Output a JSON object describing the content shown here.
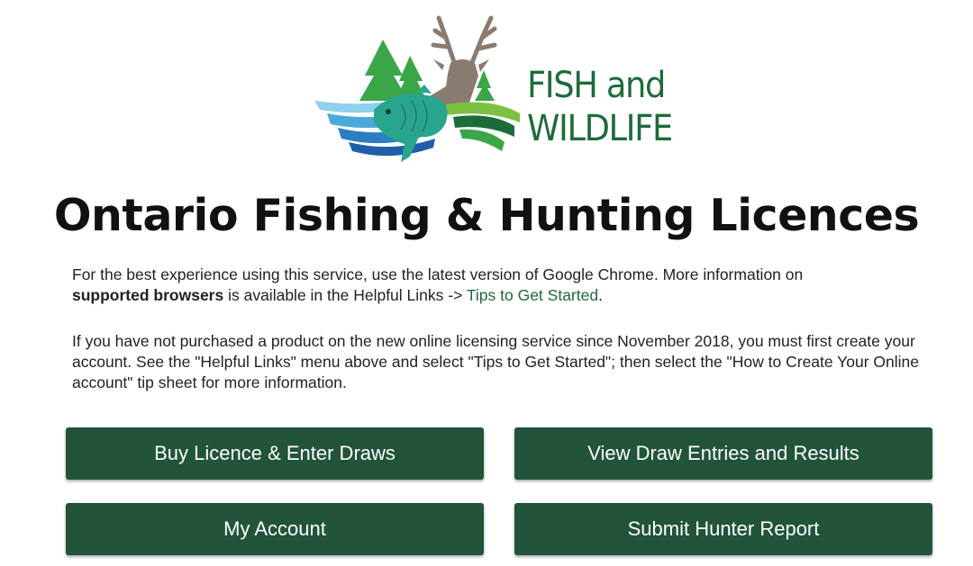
{
  "logo": {
    "line1": "FISH and",
    "line2": "WILDLIFE",
    "colors": {
      "text": "#1e6b3a",
      "tree": "#3aa648",
      "deer": "#8a7b70",
      "fish": "#2aa58d",
      "water": "#2e7cc1"
    }
  },
  "page_title": "Ontario Fishing & Hunting Licences",
  "browser_notice": {
    "text1": "For the best experience using this service, use the latest version of Google Chrome.  More information on ",
    "bold": "supported browsers",
    "text2": " is available in the Helpful Links -> ",
    "link": "Tips to Get Started",
    "text3": "."
  },
  "account_notice": "If you have not purchased a product on the new online licensing service since November 2018, you must first create your account. See the \"Helpful Links\" menu above and select \"Tips to Get Started\"; then select the \"How to Create Your Online account\" tip sheet for more information.",
  "buttons": {
    "buy": "Buy Licence & Enter Draws",
    "view_draws": "View Draw Entries and Results",
    "account": "My Account",
    "hunter_report": "Submit Hunter Report"
  },
  "colors": {
    "button_bg": "#21543a",
    "link": "#1e6b3a"
  }
}
